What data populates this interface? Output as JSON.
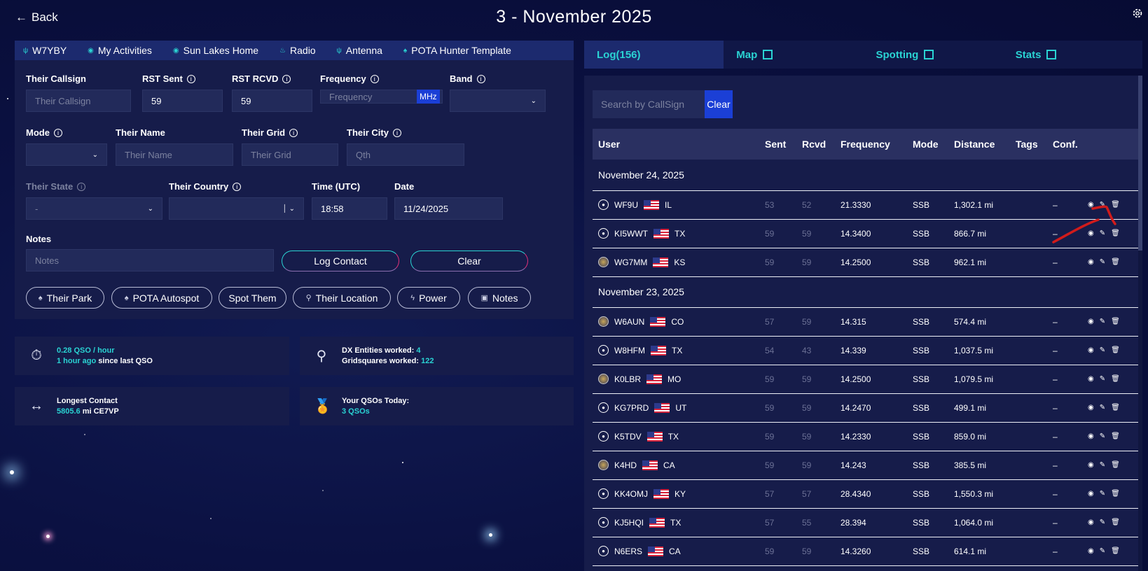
{
  "header": {
    "back_label": "Back",
    "title": "3 - November 2025"
  },
  "profile_tabs": [
    {
      "label": "W7YBY"
    },
    {
      "label": "My Activities"
    },
    {
      "label": "Sun Lakes Home"
    },
    {
      "label": "Radio"
    },
    {
      "label": "Antenna"
    },
    {
      "label": "POTA Hunter Template"
    }
  ],
  "form": {
    "their_callsign": {
      "label": "Their Callsign",
      "placeholder": "Their Callsign"
    },
    "rst_sent": {
      "label": "RST Sent",
      "value": "59"
    },
    "rst_rcvd": {
      "label": "RST RCVD",
      "value": "59"
    },
    "frequency": {
      "label": "Frequency",
      "placeholder": "Frequency",
      "unit": "MHz"
    },
    "band": {
      "label": "Band",
      "value": ""
    },
    "mode": {
      "label": "Mode",
      "value": ""
    },
    "their_name": {
      "label": "Their Name",
      "placeholder": "Their Name"
    },
    "their_grid": {
      "label": "Their Grid",
      "placeholder": "Their Grid"
    },
    "their_city": {
      "label": "Their City",
      "placeholder": "Qth"
    },
    "their_state": {
      "label": "Their State",
      "value": "-"
    },
    "their_country": {
      "label": "Their Country",
      "value": ""
    },
    "time": {
      "label": "Time (UTC)",
      "value": "18:58"
    },
    "date": {
      "label": "Date",
      "value": "11/24/2025"
    },
    "notes": {
      "label": "Notes",
      "placeholder": "Notes"
    },
    "log_contact": "Log Contact",
    "clear": "Clear"
  },
  "quick_buttons": [
    {
      "label": "Their Park"
    },
    {
      "label": "POTA Autospot"
    },
    {
      "label": "Spot Them"
    },
    {
      "label": "Their Location"
    },
    {
      "label": "Power"
    },
    {
      "label": "Notes"
    }
  ],
  "stats": {
    "rate": "0.28 QSO / hour",
    "since_last_ago": "1 hour ago",
    "since_last_text": "since last QSO",
    "dx_label": "DX Entities worked:",
    "dx_value": "4",
    "grid_label": "Gridsquares worked:",
    "grid_value": "122",
    "longest_label": "Longest Contact",
    "longest_value": "5805.6",
    "longest_unit": "mi CE7VP",
    "today_label": "Your QSOs Today:",
    "today_value": "3 QSOs"
  },
  "log_tabs": [
    {
      "label": "Log(156)"
    },
    {
      "label": "Map"
    },
    {
      "label": "Spotting"
    },
    {
      "label": "Stats"
    }
  ],
  "log": {
    "search_placeholder": "Search by CallSign",
    "clear_label": "Clear",
    "columns": [
      "User",
      "Sent",
      "Rcvd",
      "Frequency",
      "Mode",
      "Distance",
      "Tags",
      "Conf."
    ],
    "groups": [
      {
        "date": "November 24, 2025",
        "rows": [
          {
            "call": "WF9U",
            "state": "IL",
            "sent": "53",
            "rcvd": "52",
            "freq": "21.3330",
            "mode": "SSB",
            "dist": "1,302.1 mi",
            "conf": "–",
            "photo": false
          },
          {
            "call": "KI5WWT",
            "state": "TX",
            "sent": "59",
            "rcvd": "59",
            "freq": "14.3400",
            "mode": "SSB",
            "dist": "866.7 mi",
            "conf": "–",
            "photo": false
          },
          {
            "call": "WG7MM",
            "state": "KS",
            "sent": "59",
            "rcvd": "59",
            "freq": "14.2500",
            "mode": "SSB",
            "dist": "962.1 mi",
            "conf": "–",
            "photo": true
          }
        ]
      },
      {
        "date": "November 23, 2025",
        "rows": [
          {
            "call": "W6AUN",
            "state": "CO",
            "sent": "57",
            "rcvd": "59",
            "freq": "14.315",
            "mode": "SSB",
            "dist": "574.4 mi",
            "conf": "–",
            "photo": true
          },
          {
            "call": "W8HFM",
            "state": "TX",
            "sent": "54",
            "rcvd": "43",
            "freq": "14.339",
            "mode": "SSB",
            "dist": "1,037.5 mi",
            "conf": "–",
            "photo": false
          },
          {
            "call": "K0LBR",
            "state": "MO",
            "sent": "59",
            "rcvd": "59",
            "freq": "14.2500",
            "mode": "SSB",
            "dist": "1,079.5 mi",
            "conf": "–",
            "photo": true
          },
          {
            "call": "KG7PRD",
            "state": "UT",
            "sent": "59",
            "rcvd": "59",
            "freq": "14.2470",
            "mode": "SSB",
            "dist": "499.1 mi",
            "conf": "–",
            "photo": false
          },
          {
            "call": "K5TDV",
            "state": "TX",
            "sent": "59",
            "rcvd": "59",
            "freq": "14.2330",
            "mode": "SSB",
            "dist": "859.0 mi",
            "conf": "–",
            "photo": false
          },
          {
            "call": "K4HD",
            "state": "CA",
            "sent": "59",
            "rcvd": "59",
            "freq": "14.243",
            "mode": "SSB",
            "dist": "385.5 mi",
            "conf": "–",
            "photo": true
          },
          {
            "call": "KK4OMJ",
            "state": "KY",
            "sent": "57",
            "rcvd": "57",
            "freq": "28.4340",
            "mode": "SSB",
            "dist": "1,550.3 mi",
            "conf": "–",
            "photo": false
          },
          {
            "call": "KJ5HQI",
            "state": "TX",
            "sent": "57",
            "rcvd": "55",
            "freq": "28.394",
            "mode": "SSB",
            "dist": "1,064.0 mi",
            "conf": "–",
            "photo": false
          },
          {
            "call": "N6ERS",
            "state": "CA",
            "sent": "59",
            "rcvd": "59",
            "freq": "14.3260",
            "mode": "SSB",
            "dist": "614.1 mi",
            "conf": "–",
            "photo": false
          }
        ]
      }
    ]
  },
  "colors": {
    "accent": "#2ad3d3",
    "button_blue": "#1b3fd6",
    "annotation_red": "#d11b1b"
  }
}
